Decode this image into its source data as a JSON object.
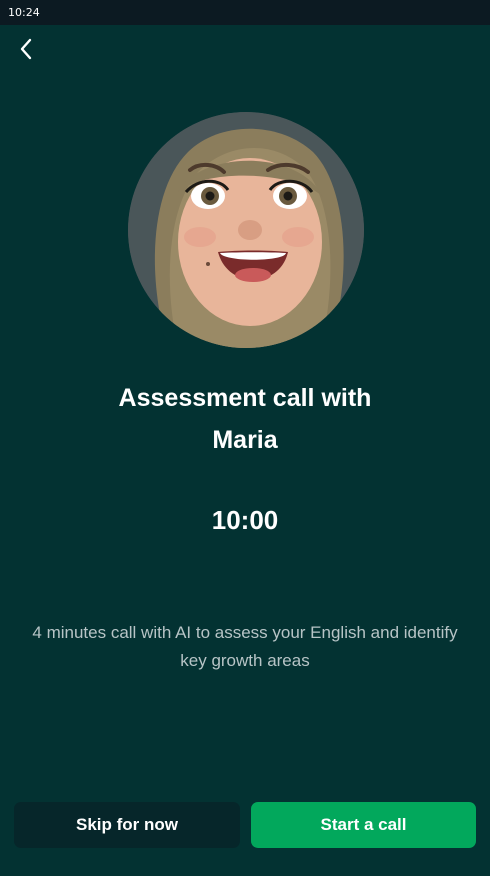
{
  "status_bar": {
    "time": "10:24"
  },
  "header": {
    "back_icon": "chevron-left-icon"
  },
  "avatar": {
    "icon": "memoji-avatar",
    "background": "#4a5659"
  },
  "call": {
    "title_line1": "Assessment call with",
    "title_line2": "Maria",
    "timer": "10:00",
    "description": "4 minutes call with AI to assess your English and identify key growth areas"
  },
  "actions": {
    "skip_label": "Skip for now",
    "start_label": "Start a call"
  },
  "colors": {
    "screen_background": "#033232",
    "primary_button": "#02a85c",
    "secondary_button": "#06262a",
    "muted_text": "#b7c4c6"
  }
}
